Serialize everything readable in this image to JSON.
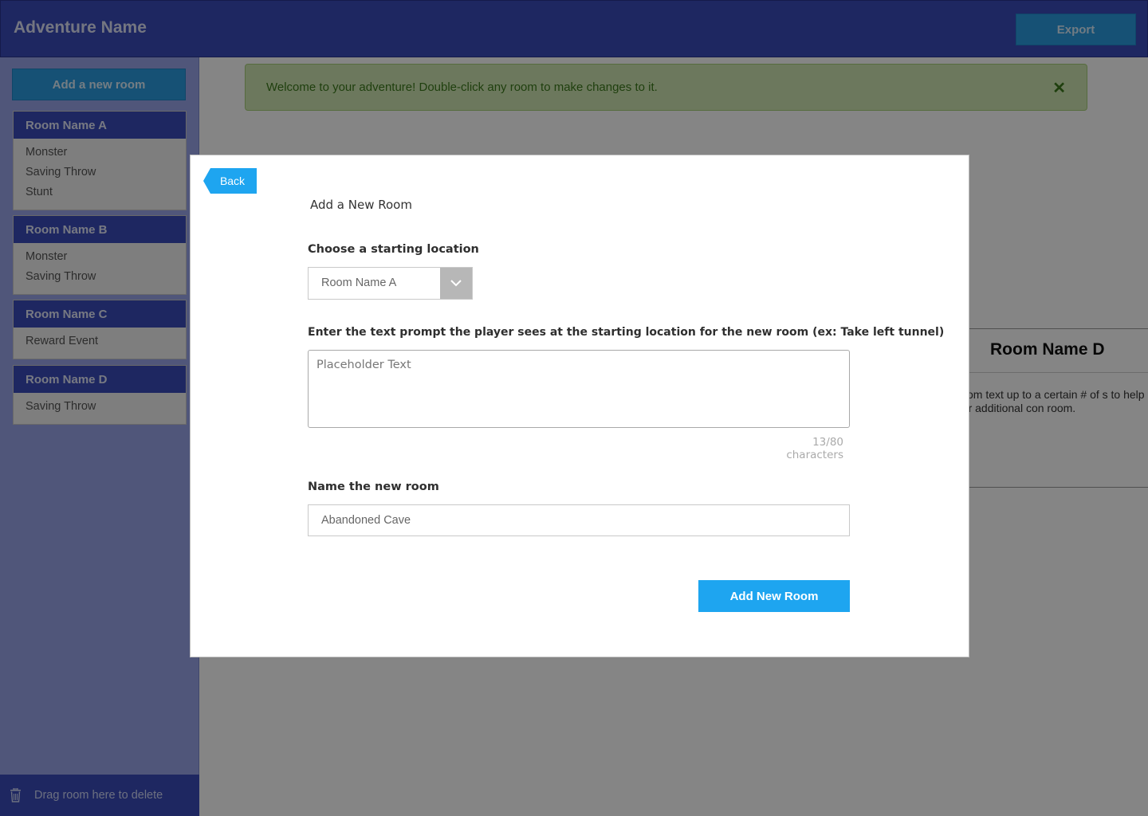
{
  "header": {
    "title": "Adventure Name",
    "export_label": "Export"
  },
  "sidebar": {
    "add_room_label": "Add a new room",
    "rooms": [
      {
        "name": "Room Name A",
        "items": [
          "Monster",
          "Saving Throw",
          "Stunt"
        ]
      },
      {
        "name": "Room Name B",
        "items": [
          "Monster",
          "Saving Throw"
        ]
      },
      {
        "name": "Room Name C",
        "items": [
          "Reward Event"
        ]
      },
      {
        "name": "Room Name D",
        "items": [
          "Saving Throw"
        ]
      }
    ],
    "trash_label": "Drag room here to delete"
  },
  "main": {
    "alert_text": "Welcome to your adventure! Double-click any room to make changes to it.",
    "alert_close": "✕",
    "room_detail": {
      "title": "Room Name D",
      "text": "r room text up to a certain # of s to help give the user additional con room."
    }
  },
  "modal": {
    "back_label": "Back",
    "title": "Add a New Room",
    "start_label": "Choose a starting location",
    "start_selected": "Room Name A",
    "prompt_label": "Enter the text prompt the player sees at the starting location for the new room (ex: Take left tunnel)",
    "prompt_placeholder": "Placeholder Text",
    "char_count": "13/80 characters",
    "name_label": "Name the new room",
    "name_value": "Abandoned Cave",
    "submit_label": "Add New Room"
  },
  "colors": {
    "primary": "#3a4bbb",
    "accent": "#1ea5f0",
    "success_bg": "#cfe7b3"
  }
}
